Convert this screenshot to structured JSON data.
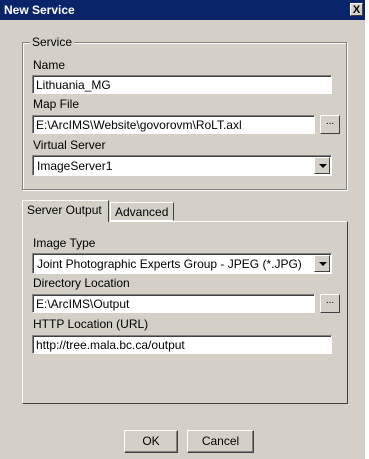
{
  "window": {
    "title": "New Service",
    "close_glyph": "X"
  },
  "service_group": {
    "legend": "Service",
    "name_label": "Name",
    "name_value": "Lithuania_MG",
    "map_file_label": "Map File",
    "map_file_value": "E:\\ArcIMS\\Website\\govorovm\\RoLT.axl",
    "virtual_server_label": "Virtual Server",
    "virtual_server_value": "ImageServer1",
    "browse_label": "..."
  },
  "tabs": [
    {
      "label": "Server Output",
      "active": true
    },
    {
      "label": "Advanced",
      "active": false
    }
  ],
  "server_output": {
    "image_type_label": "Image Type",
    "image_type_value": "Joint Photographic Experts Group - JPEG (*.JPG)",
    "directory_label": "Directory Location",
    "directory_value": "E:\\ArcIMS\\Output",
    "http_label": "HTTP Location (URL)",
    "http_value": "http://tree.mala.bc.ca/output",
    "browse_label": "..."
  },
  "buttons": {
    "ok": "OK",
    "cancel": "Cancel"
  },
  "colors": {
    "titlebar": "#0a246a",
    "dialog_face": "#d4d0c8"
  }
}
